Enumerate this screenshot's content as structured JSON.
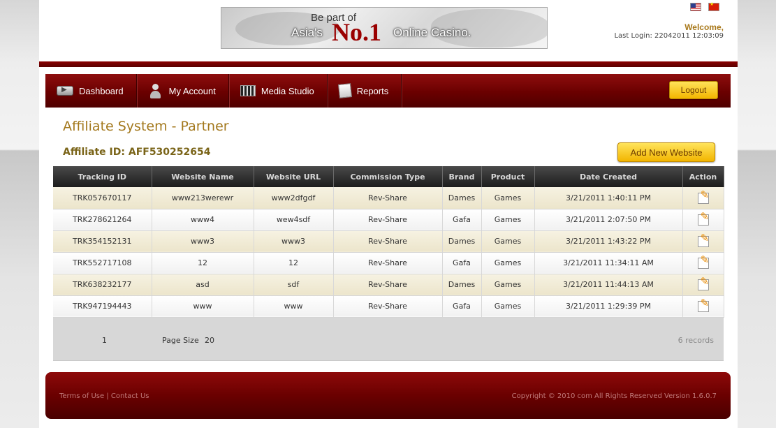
{
  "banner": {
    "line1": "Be part of",
    "line2_prefix": "Asia's",
    "line2_number": "No.1",
    "line2_suffix": "Online Casino."
  },
  "header": {
    "welcome": "Welcome,",
    "last_login": "Last Login: 22042011 12:03:09"
  },
  "nav": {
    "items": [
      {
        "label": "Dashboard",
        "icon": "dashboard-icon"
      },
      {
        "label": "My Account",
        "icon": "user-icon"
      },
      {
        "label": "Media Studio",
        "icon": "clapperboard-icon"
      },
      {
        "label": "Reports",
        "icon": "report-icon"
      }
    ],
    "logout_label": "Logout"
  },
  "main": {
    "title": "Affiliate System - Partner",
    "affiliate_id": "Affiliate ID: AFF530252654",
    "add_button_label": "Add New Website"
  },
  "table": {
    "headers": [
      "Tracking ID",
      "Website Name",
      "Website URL",
      "Commission Type",
      "Brand",
      "Product",
      "Date Created",
      "Action"
    ],
    "rows": [
      [
        "TRK057670117",
        "www213werewr",
        "www2dfgdf",
        "Rev-Share",
        "Dames",
        "Games",
        "3/21/2011 1:40:11 PM"
      ],
      [
        "TRK278621264",
        "www4",
        "wew4sdf",
        "Rev-Share",
        "Gafa",
        "Games",
        "3/21/2011 2:07:50 PM"
      ],
      [
        "TRK354152131",
        "www3",
        "www3",
        "Rev-Share",
        "Dames",
        "Games",
        "3/21/2011 1:43:22 PM"
      ],
      [
        "TRK552717108",
        "12",
        "12",
        "Rev-Share",
        "Gafa",
        "Games",
        "3/21/2011 11:34:11 AM"
      ],
      [
        "TRK638232177",
        "asd",
        "sdf",
        "Rev-Share",
        "Dames",
        "Games",
        "3/21/2011 11:44:13 AM"
      ],
      [
        "TRK947194443",
        "www",
        "www",
        "Rev-Share",
        "Gafa",
        "Games",
        "3/21/2011 1:29:39 PM"
      ]
    ],
    "action_icon": "edit-icon"
  },
  "pager": {
    "page": "1",
    "page_size_label": "Page Size",
    "page_size": "20",
    "records": "6 records"
  },
  "footer": {
    "terms": "Terms of Use",
    "separator": "|",
    "contact": "Contact Us",
    "copyright": "Copyright © 2010 com All Rights Reserved  Version 1.6.0.7"
  },
  "colors": {
    "brand_red": "#6a0000",
    "accent_gold": "#a3781c",
    "button_yellow": "#f3b600"
  }
}
